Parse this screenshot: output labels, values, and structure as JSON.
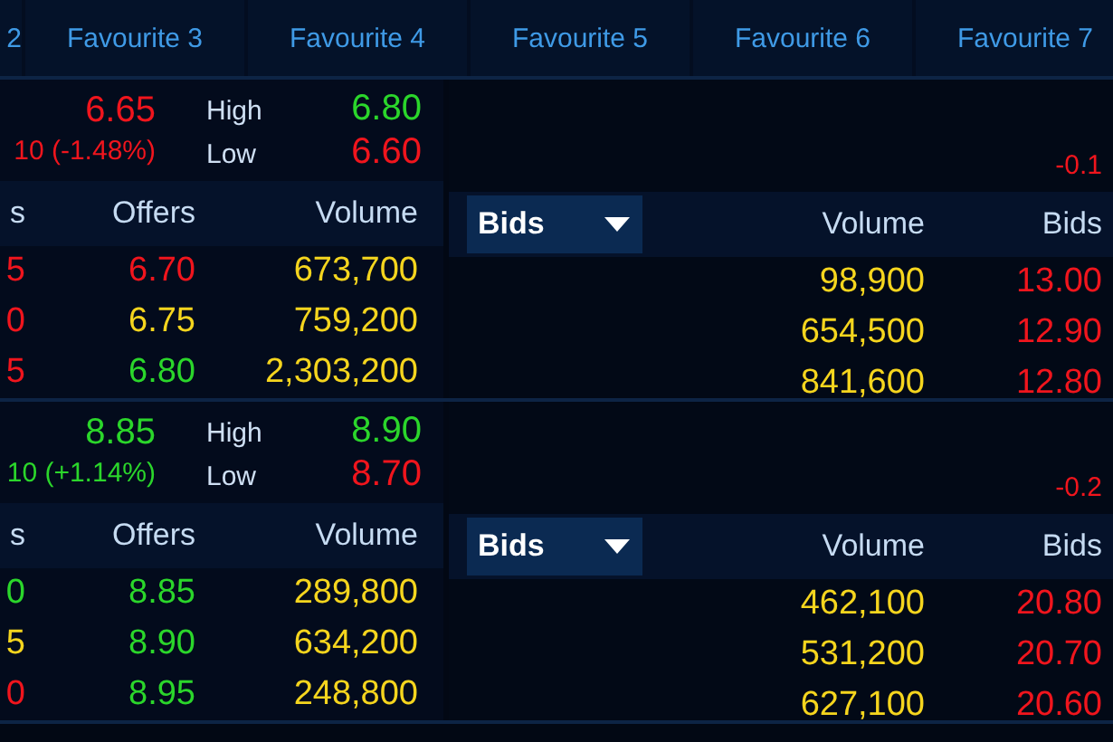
{
  "tabs": [
    {
      "label": "2"
    },
    {
      "label": "Favourite 3"
    },
    {
      "label": "Favourite 4"
    },
    {
      "label": "Favourite 5"
    },
    {
      "label": "Favourite 6"
    },
    {
      "label": "Favourite 7"
    }
  ],
  "quotes": [
    {
      "left": {
        "price": {
          "text": "6.65",
          "color": "#f0151d"
        },
        "change": {
          "text": "10 (-1.48%)",
          "color": "#f0151d"
        },
        "high_label": "High",
        "high": {
          "text": "6.80",
          "color": "#2bd62b"
        },
        "low_label": "Low",
        "low": {
          "text": "6.60",
          "color": "#f0151d"
        },
        "columns": [
          "s",
          "Offers",
          "Volume"
        ],
        "rows": [
          {
            "bid": {
              "text": "5",
              "color": "#f0151d"
            },
            "offer": {
              "text": "6.70",
              "color": "#f0151d"
            },
            "volume": "673,700"
          },
          {
            "bid": {
              "text": "0",
              "color": "#f0151d"
            },
            "offer": {
              "text": "6.75",
              "color": "#f5d51e"
            },
            "volume": "759,200"
          },
          {
            "bid": {
              "text": "5",
              "color": "#f0151d"
            },
            "offer": {
              "text": "6.80",
              "color": "#2bd62b"
            },
            "volume": "2,303,200"
          }
        ]
      },
      "right": {
        "change": {
          "text": "-0.1",
          "color": "#f0151d"
        },
        "dropdown": "Bids",
        "columns": [
          "Volume",
          "Bids"
        ],
        "rows": [
          {
            "volume": "98,900",
            "bid": {
              "text": "13.00",
              "color": "#f0151d"
            }
          },
          {
            "volume": "654,500",
            "bid": {
              "text": "12.90",
              "color": "#f0151d"
            }
          },
          {
            "volume": "841,600",
            "bid": {
              "text": "12.80",
              "color": "#f0151d"
            }
          }
        ]
      }
    },
    {
      "left": {
        "price": {
          "text": "8.85",
          "color": "#2bd62b"
        },
        "change": {
          "text": "10 (+1.14%)",
          "color": "#2bd62b"
        },
        "high_label": "High",
        "high": {
          "text": "8.90",
          "color": "#2bd62b"
        },
        "low_label": "Low",
        "low": {
          "text": "8.70",
          "color": "#f0151d"
        },
        "columns": [
          "s",
          "Offers",
          "Volume"
        ],
        "rows": [
          {
            "bid": {
              "text": "0",
              "color": "#2bd62b"
            },
            "offer": {
              "text": "8.85",
              "color": "#2bd62b"
            },
            "volume": "289,800"
          },
          {
            "bid": {
              "text": "5",
              "color": "#f5d51e"
            },
            "offer": {
              "text": "8.90",
              "color": "#2bd62b"
            },
            "volume": "634,200"
          },
          {
            "bid": {
              "text": "0",
              "color": "#f0151d"
            },
            "offer": {
              "text": "8.95",
              "color": "#2bd62b"
            },
            "volume": "248,800"
          }
        ]
      },
      "right": {
        "change": {
          "text": "-0.2",
          "color": "#f0151d"
        },
        "dropdown": "Bids",
        "columns": [
          "Volume",
          "Bids"
        ],
        "rows": [
          {
            "volume": "462,100",
            "bid": {
              "text": "20.80",
              "color": "#f0151d"
            }
          },
          {
            "volume": "531,200",
            "bid": {
              "text": "20.70",
              "color": "#f0151d"
            }
          },
          {
            "volume": "627,100",
            "bid": {
              "text": "20.60",
              "color": "#f0151d"
            }
          }
        ]
      }
    }
  ]
}
